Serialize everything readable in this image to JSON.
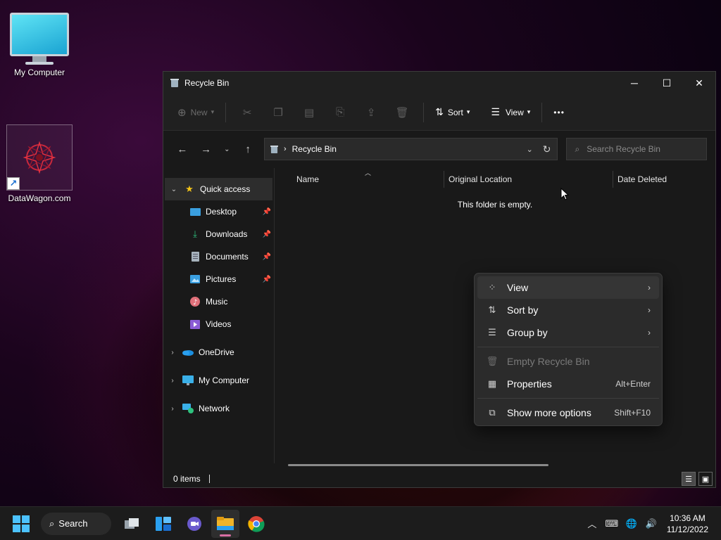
{
  "desktop": {
    "icons": [
      {
        "label": "My Computer"
      },
      {
        "label": "DataWagon.com"
      }
    ]
  },
  "window": {
    "title": "Recycle Bin",
    "controls": {
      "minimize": "─",
      "maximize": "☐",
      "close": "✕"
    }
  },
  "toolbar": {
    "new_label": "New",
    "sort_label": "Sort",
    "view_label": "View",
    "more_label": "•••"
  },
  "address": {
    "crumb": "Recycle Bin",
    "search_placeholder": "Search Recycle Bin"
  },
  "nav": {
    "quick_access": "Quick access",
    "pinned": [
      {
        "label": "Desktop",
        "icon": "desktop-folder-icon",
        "pinned": true
      },
      {
        "label": "Downloads",
        "icon": "downloads-folder-icon",
        "pinned": true
      },
      {
        "label": "Documents",
        "icon": "documents-folder-icon",
        "pinned": true
      },
      {
        "label": "Pictures",
        "icon": "pictures-folder-icon",
        "pinned": true
      },
      {
        "label": "Music",
        "icon": "music-folder-icon",
        "pinned": false
      },
      {
        "label": "Videos",
        "icon": "videos-folder-icon",
        "pinned": false
      }
    ],
    "roots": [
      {
        "label": "OneDrive",
        "icon": "onedrive-icon"
      },
      {
        "label": "My Computer",
        "icon": "computer-icon"
      },
      {
        "label": "Network",
        "icon": "network-icon"
      }
    ]
  },
  "content": {
    "columns": [
      "Name",
      "Original Location",
      "Date Deleted"
    ],
    "empty_message": "This folder is empty."
  },
  "status": {
    "items": "0 items"
  },
  "context_menu": {
    "items": [
      {
        "label": "View",
        "icon": "grid-icon",
        "submenu": "›"
      },
      {
        "label": "Sort by",
        "icon": "sort-icon",
        "submenu": "›"
      },
      {
        "label": "Group by",
        "icon": "group-icon",
        "submenu": "›"
      },
      {
        "label": "Empty Recycle Bin",
        "icon": "trash-icon",
        "disabled": true
      },
      {
        "label": "Properties",
        "icon": "properties-icon",
        "shortcut": "Alt+Enter"
      },
      {
        "label": "Show more options",
        "icon": "more-options-icon",
        "shortcut": "Shift+F10"
      }
    ]
  },
  "taskbar": {
    "search_label": "Search",
    "time": "10:36 AM",
    "date": "11/12/2022"
  },
  "colors": {
    "accent": "#4cc2ff",
    "window_bg": "#191919",
    "menu_bg": "#2b2b2b"
  }
}
